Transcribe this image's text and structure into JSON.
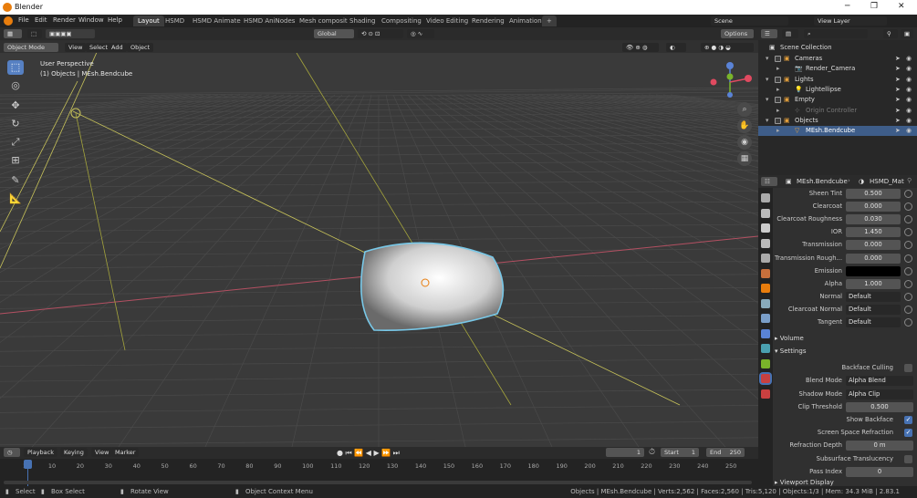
{
  "app": {
    "title": "Blender"
  },
  "menu": [
    "File",
    "Edit",
    "Render",
    "Window",
    "Help"
  ],
  "workspaces": [
    "Layout",
    "HSMD",
    "HSMD Animate",
    "HSMD AniNodes",
    "Mesh composit",
    "Shading",
    "Compositing",
    "Video Editing",
    "Rendering",
    "Animation"
  ],
  "active_workspace": "Layout",
  "scene": {
    "name": "Scene",
    "view_layer": "View Layer"
  },
  "viewport_header": {
    "mode": "Object Mode",
    "menus": [
      "View",
      "Select",
      "Add",
      "Object"
    ],
    "transform": "Global",
    "options": "Options"
  },
  "viewport": {
    "perspective": "User Perspective",
    "object_info": "(1) Objects | MEsh.Bendcube"
  },
  "outliner": {
    "root": "Scene Collection",
    "rows": [
      {
        "label": "Cameras"
      },
      {
        "label": "Render_Camera"
      },
      {
        "label": "Lights"
      },
      {
        "label": "Lightellipse"
      },
      {
        "label": "Empty"
      },
      {
        "label": "Origin Controller"
      },
      {
        "label": "Objects"
      },
      {
        "label": "MEsh.Bendcube"
      }
    ]
  },
  "properties": {
    "breadcrumb_object": "MEsh.Bendcube",
    "breadcrumb_material": "HSMD_Mat",
    "rows": [
      {
        "label": "Sheen Tint",
        "value": "0.500"
      },
      {
        "label": "Clearcoat",
        "value": "0.000"
      },
      {
        "label": "Clearcoat Roughness",
        "value": "0.030"
      },
      {
        "label": "IOR",
        "value": "1.450"
      },
      {
        "label": "Transmission",
        "value": "0.000"
      },
      {
        "label": "Transmission Rough...",
        "value": "0.000"
      },
      {
        "label": "Emission",
        "value": ""
      },
      {
        "label": "Alpha",
        "value": "1.000"
      },
      {
        "label": "Normal",
        "value": "Default"
      },
      {
        "label": "Clearcoat Normal",
        "value": "Default"
      },
      {
        "label": "Tangent",
        "value": "Default"
      }
    ],
    "volume": "Volume",
    "settings": "Settings",
    "settings_rows": [
      {
        "label": "Backface Culling",
        "value": ""
      },
      {
        "label": "Blend Mode",
        "value": "Alpha Blend"
      },
      {
        "label": "Shadow Mode",
        "value": "Alpha Clip"
      },
      {
        "label": "Clip Threshold",
        "value": "0.500"
      },
      {
        "label": "Show Backface",
        "value": ""
      },
      {
        "label": "Screen Space Refraction",
        "value": ""
      },
      {
        "label": "Refraction Depth",
        "value": "0 m"
      },
      {
        "label": "Subsurface Translucency",
        "value": ""
      },
      {
        "label": "Pass Index",
        "value": "0"
      }
    ],
    "viewport_display": "Viewport Display"
  },
  "timeline": {
    "menus": [
      "Playback",
      "Keying",
      "View",
      "Marker"
    ],
    "current_frame": "1",
    "start_label": "Start",
    "start": "1",
    "end_label": "End",
    "end": "250",
    "ticks": [
      "1",
      "10",
      "20",
      "30",
      "40",
      "50",
      "60",
      "70",
      "80",
      "90",
      "100",
      "110",
      "120",
      "130",
      "140",
      "150",
      "160",
      "170",
      "180",
      "190",
      "200",
      "210",
      "220",
      "230",
      "240",
      "250"
    ]
  },
  "statusbar": {
    "select": "Select",
    "box_select": "Box Select",
    "rotate": "Rotate View",
    "context": "Object Context Menu",
    "stats": "Objects | MEsh.Bendcube | Verts:2,562 | Faces:2,560 | Tris:5,120 | Objects:1/3 | Mem: 34.3 MiB | 2.83.1"
  },
  "colors": {
    "accent": "#4772b3",
    "origin": "#e87d0d",
    "viewport": "#3a3a3a"
  }
}
